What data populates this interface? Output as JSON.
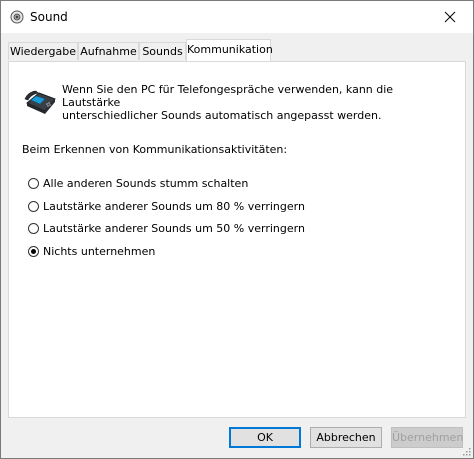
{
  "window": {
    "title": "Sound",
    "close_glyph": "✕"
  },
  "tabs": [
    {
      "label": "Wiedergabe",
      "active": false
    },
    {
      "label": "Aufnahme",
      "active": false
    },
    {
      "label": "Sounds",
      "active": false
    },
    {
      "label": "Kommunikation",
      "active": true
    }
  ],
  "panel": {
    "info_line1": "Wenn Sie den PC für Telefongespräche verwenden, kann die Lautstärke",
    "info_line2": "unterschiedlicher Sounds automatisch angepasst werden.",
    "detect_label": "Beim Erkennen von Kommunikationsaktivitäten:",
    "options": [
      {
        "label": "Alle anderen Sounds stumm schalten",
        "checked": false
      },
      {
        "label": "Lautstärke anderer Sounds um 80 % verringern",
        "checked": false
      },
      {
        "label": "Lautstärke anderer Sounds um 50 % verringern",
        "checked": false
      },
      {
        "label": "Nichts unternehmen",
        "checked": true
      }
    ]
  },
  "buttons": {
    "ok": "OK",
    "cancel": "Abbrechen",
    "apply": "Übernehmen"
  },
  "colors": {
    "accent": "#0078d7",
    "dialog_bg": "#f0f0f0",
    "panel_bg": "#ffffff"
  }
}
